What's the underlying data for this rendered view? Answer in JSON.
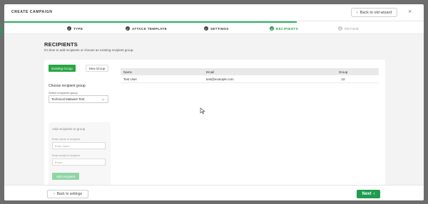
{
  "header": {
    "title": "CREATE CAMPAIGN",
    "back_old_wizard": "Back to old wizard",
    "back_arrow": "‹",
    "close": "×"
  },
  "steps": [
    {
      "label": "TYPE",
      "mark": "✓"
    },
    {
      "label": "ATTACK TEMPLATE",
      "mark": "✓"
    },
    {
      "label": "SETTINGS",
      "mark": "✓"
    },
    {
      "label": "RECIPIENTS",
      "mark": "4"
    },
    {
      "label": "REVIEW",
      "mark": "5"
    }
  ],
  "main": {
    "title": "RECIPIENTS",
    "subtitle": "It's time to add recipients or choose an existing recipient group."
  },
  "group_toggle": {
    "existing": "Existing Group",
    "new": "New Group"
  },
  "choose_group": {
    "label": "Choose recipient group",
    "select_label": "Select recipients group",
    "selected": "Technical Malware Test",
    "chevron": "⌄"
  },
  "add_panel": {
    "title": "Add recipients to group",
    "name_label": "Enter name of recipient",
    "name_placeholder": "Enter name",
    "email_label": "Enter email of recipient",
    "email_placeholder": "Email",
    "add_button": "Add recipient"
  },
  "table": {
    "headers": {
      "name": "Name",
      "email": "Email",
      "group": "Group"
    },
    "rows": [
      {
        "name": "Test User",
        "email": "test@example.com",
        "group": "10"
      }
    ]
  },
  "footer": {
    "back": "Back to settings",
    "back_arrow": "‹",
    "next": "Next",
    "next_arrow": "›"
  },
  "colors": {
    "accent": "#28a745",
    "accent_dark": "#1f9d4e",
    "active_step": "#2a9d50"
  }
}
